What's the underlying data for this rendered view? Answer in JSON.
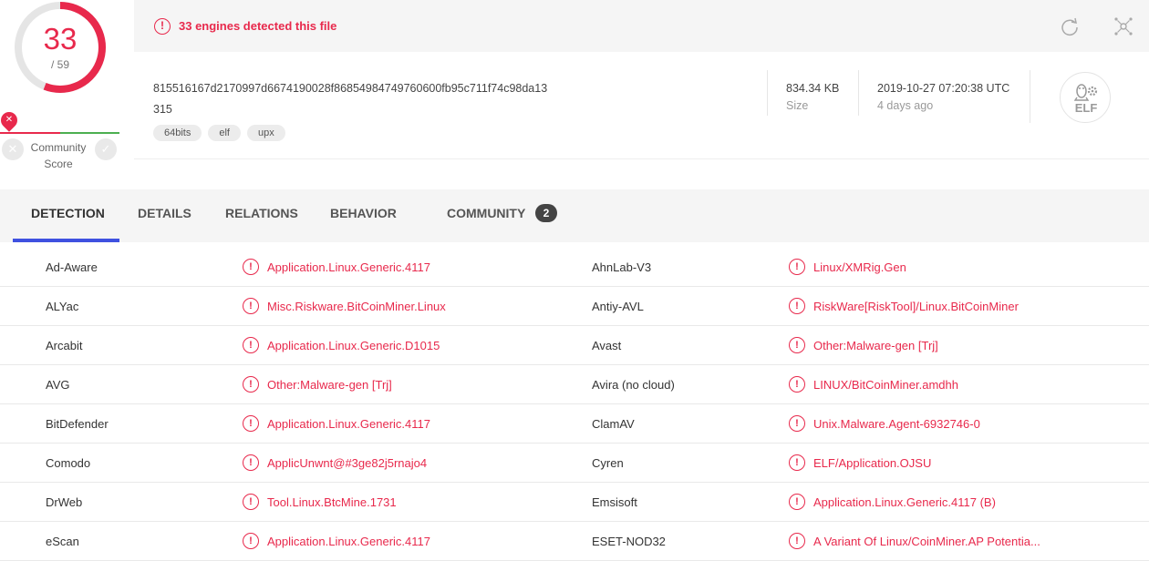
{
  "score": {
    "detected": "33",
    "total": "/ 59",
    "fraction": 0.559
  },
  "community": {
    "label_line1": "Community",
    "label_line2": "Score",
    "negative_icon": "x-icon",
    "positive_icon": "check-icon",
    "marker_icon": "x-icon"
  },
  "banner": {
    "text": "33 engines detected this file",
    "icon": "alert-circle-icon"
  },
  "toolbar": {
    "refresh_icon": "refresh-icon",
    "graph_icon": "graph-icon"
  },
  "file": {
    "hash_line1": "815516167d2170997d6674190028f86854984749760600fb95c711f74c98da13",
    "hash_line2": "315",
    "tags": [
      "64bits",
      "elf",
      "upx"
    ],
    "size_value": "834.34 KB",
    "size_label": "Size",
    "date_value": "2019-10-27 07:20:38 UTC",
    "date_ago": "4 days ago",
    "type_badge": "ELF"
  },
  "tabs": {
    "detection": "DETECTION",
    "details": "DETAILS",
    "relations": "RELATIONS",
    "behavior": "BEHAVIOR",
    "community": "COMMUNITY",
    "community_count": "2"
  },
  "detections": [
    {
      "left_engine": "Ad-Aware",
      "left_result": "Application.Linux.Generic.4117",
      "right_engine": "AhnLab-V3",
      "right_result": "Linux/XMRig.Gen"
    },
    {
      "left_engine": "ALYac",
      "left_result": "Misc.Riskware.BitCoinMiner.Linux",
      "right_engine": "Antiy-AVL",
      "right_result": "RiskWare[RiskTool]/Linux.BitCoinMiner"
    },
    {
      "left_engine": "Arcabit",
      "left_result": "Application.Linux.Generic.D1015",
      "right_engine": "Avast",
      "right_result": "Other:Malware-gen [Trj]"
    },
    {
      "left_engine": "AVG",
      "left_result": "Other:Malware-gen [Trj]",
      "right_engine": "Avira (no cloud)",
      "right_result": "LINUX/BitCoinMiner.amdhh"
    },
    {
      "left_engine": "BitDefender",
      "left_result": "Application.Linux.Generic.4117",
      "right_engine": "ClamAV",
      "right_result": "Unix.Malware.Agent-6932746-0"
    },
    {
      "left_engine": "Comodo",
      "left_result": "ApplicUnwnt@#3ge82j5rnajo4",
      "right_engine": "Cyren",
      "right_result": "ELF/Application.OJSU"
    },
    {
      "left_engine": "DrWeb",
      "left_result": "Tool.Linux.BtcMine.1731",
      "right_engine": "Emsisoft",
      "right_result": "Application.Linux.Generic.4117 (B)"
    },
    {
      "left_engine": "eScan",
      "left_result": "Application.Linux.Generic.4117",
      "right_engine": "ESET-NOD32",
      "right_result": "A Variant Of Linux/CoinMiner.AP Potentia..."
    }
  ],
  "colors": {
    "accent": "#e8294c",
    "tab_underline": "#3f51e0",
    "positive": "#4caf50"
  }
}
